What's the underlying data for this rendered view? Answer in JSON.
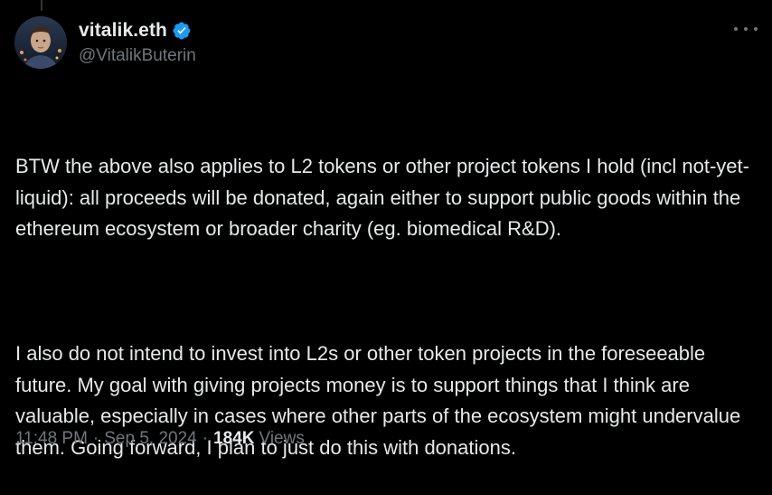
{
  "author": {
    "display_name": "vitalik.eth",
    "handle": "@VitalikButerin",
    "verified": true
  },
  "tweet": {
    "paragraphs": [
      "BTW the above also applies to L2 tokens or other project tokens I hold (incl not-yet-liquid): all proceeds will be donated, again either to support public goods within the ethereum ecosystem or broader charity (eg. biomedical R&D).",
      "I also do not intend to invest into L2s or other token projects in the foreseeable future. My goal with giving projects money is to support things that I think are valuable, especially in cases where other parts of the ecosystem might undervalue them. Going forward, I plan to just do this with donations."
    ],
    "time": "11:48 PM",
    "separator": "·",
    "date": "Sep 5, 2024",
    "views_count": "184K",
    "views_label": "Views"
  },
  "icons": {
    "verified": "verified-badge-icon",
    "more": "more-horizontal-icon"
  },
  "colors": {
    "background": "#000000",
    "text_primary": "#e7e9ea",
    "text_secondary": "#71767b",
    "verified_blue": "#1d9bf0"
  }
}
